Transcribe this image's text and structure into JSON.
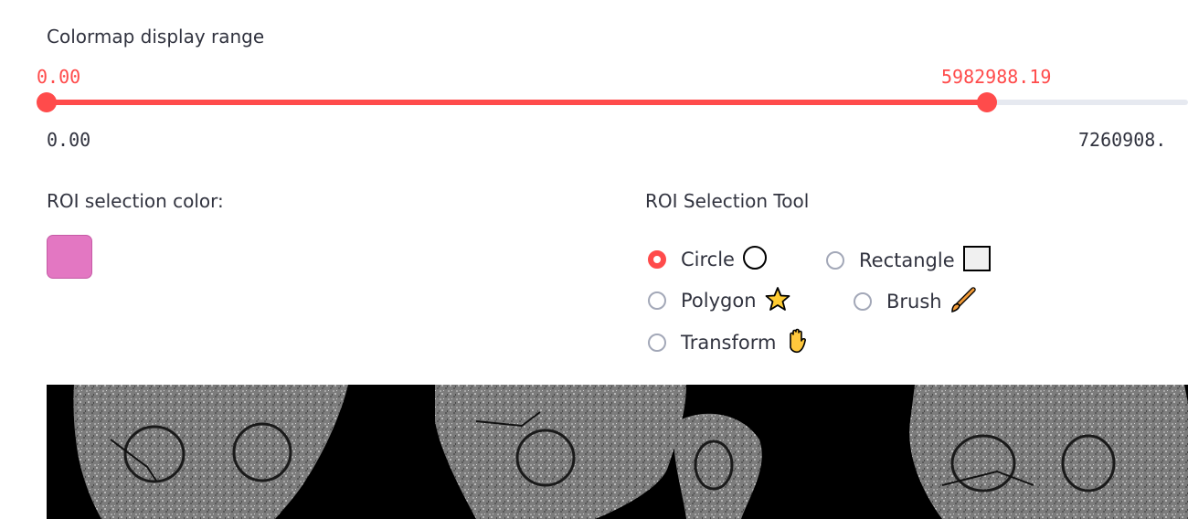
{
  "colormap": {
    "title": "Colormap display range",
    "range_low_value": "0.00",
    "range_high_value": "5982988.19",
    "min_label": "0.00",
    "max_label": "7260908.",
    "low_fraction": 0.0,
    "high_fraction": 0.824,
    "accent_color": "#ff4b4b",
    "track_color": "#e6e9f0"
  },
  "roi_color": {
    "label": "ROI selection color:",
    "value": "#e377c2"
  },
  "roi_tool": {
    "label": "ROI Selection Tool",
    "selected": "Circle",
    "options": [
      {
        "label": "Circle",
        "icon": "circle-icon"
      },
      {
        "label": "Rectangle",
        "icon": "square-icon"
      },
      {
        "label": "Polygon",
        "icon": "star-icon"
      },
      {
        "label": "Brush",
        "icon": "paintbrush-icon"
      },
      {
        "label": "Transform",
        "icon": "hand-icon"
      }
    ]
  }
}
